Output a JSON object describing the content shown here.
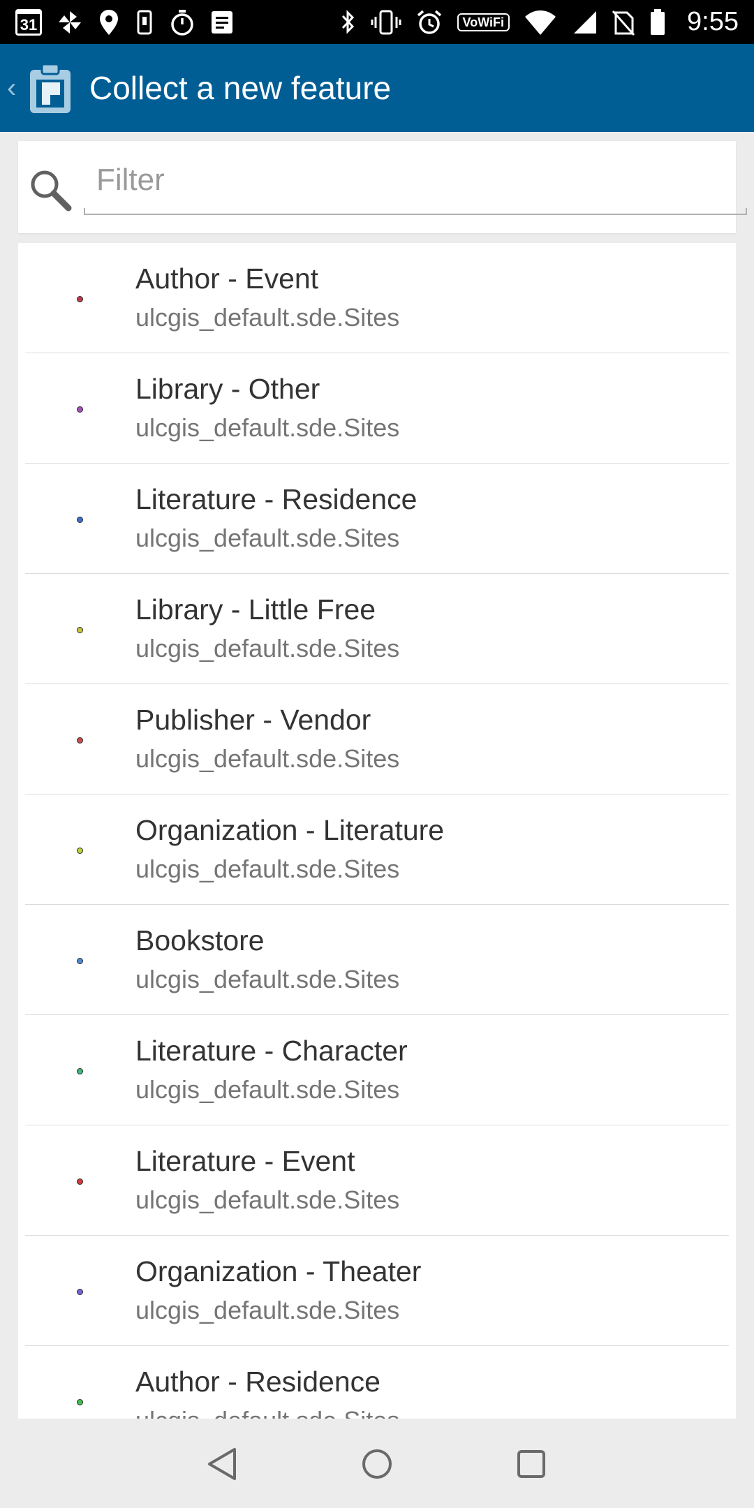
{
  "status_bar": {
    "calendar_day": "31",
    "vowifi_label": "VoWiFi",
    "time": "9:55",
    "left_icons": [
      "calendar-icon",
      "pinwheel-icon",
      "location-pin-icon",
      "phone-sync-icon",
      "stopwatch-icon",
      "notes-icon"
    ],
    "right_icons": [
      "bluetooth-icon",
      "vibrate-icon",
      "alarm-icon",
      "vowifi-icon",
      "wifi-icon",
      "cell-signal-icon",
      "no-sim-icon",
      "battery-icon"
    ]
  },
  "app_bar": {
    "title": "Collect a new feature",
    "background": "#005e95",
    "back_icon": "chevron-left-icon",
    "logo_icon": "clipboard-icon"
  },
  "filter": {
    "placeholder": "Filter",
    "value": "",
    "icon": "search-icon"
  },
  "features": [
    {
      "title": "Author - Event",
      "source": "ulcgis_default.sde.Sites",
      "color": "#c0394a"
    },
    {
      "title": "Library - Other",
      "source": "ulcgis_default.sde.Sites",
      "color": "#a64dbf"
    },
    {
      "title": "Literature - Residence",
      "source": "ulcgis_default.sde.Sites",
      "color": "#3b6fd1"
    },
    {
      "title": "Library - Little Free",
      "source": "ulcgis_default.sde.Sites",
      "color": "#c9c43a"
    },
    {
      "title": "Publisher - Vendor",
      "source": "ulcgis_default.sde.Sites",
      "color": "#c94f4f"
    },
    {
      "title": "Organization - Literature",
      "source": "ulcgis_default.sde.Sites",
      "color": "#b6d43a"
    },
    {
      "title": "Bookstore",
      "source": "ulcgis_default.sde.Sites",
      "color": "#4f86d9"
    },
    {
      "title": "Literature - Character",
      "source": "ulcgis_default.sde.Sites",
      "color": "#3cb87a"
    },
    {
      "title": "Literature - Event",
      "source": "ulcgis_default.sde.Sites",
      "color": "#d63a3a"
    },
    {
      "title": "Organization - Theater",
      "source": "ulcgis_default.sde.Sites",
      "color": "#7a5fd6"
    },
    {
      "title": "Author - Residence",
      "source": "ulcgis_default.sde.Sites",
      "color": "#3fbf4f"
    }
  ],
  "nav_bar": {
    "icons": [
      "back-triangle-icon",
      "home-circle-icon",
      "recents-square-icon"
    ]
  }
}
